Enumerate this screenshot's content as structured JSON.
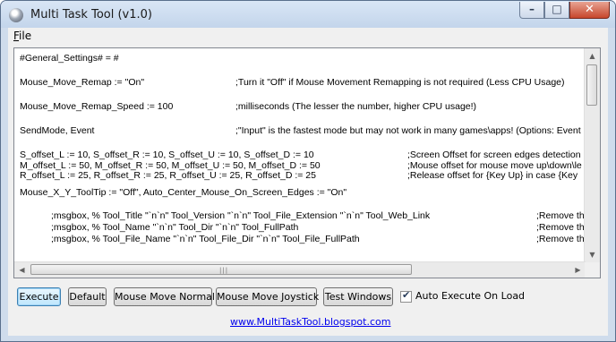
{
  "window": {
    "title": "Multi Task Tool (v1.0)",
    "caption_buttons": {
      "minimize": "–",
      "maximize": "□",
      "close": "✕"
    }
  },
  "menu": {
    "file_label": "File"
  },
  "editor": {
    "lines": [
      {
        "code": "#General_Settings# = #",
        "comment": ""
      },
      {
        "code": "",
        "comment": ""
      },
      {
        "code": "Mouse_Move_Remap := \"On\"",
        "comment": ";Turn it \"Off\" if Mouse Movement Remapping is not required (Less CPU Usage)"
      },
      {
        "code": "",
        "comment": ""
      },
      {
        "code": "Mouse_Move_Remap_Speed := 100",
        "comment": ";milliseconds (The lesser the number, higher CPU usage!)"
      },
      {
        "code": "",
        "comment": ""
      },
      {
        "code": "SendMode, Event",
        "comment": ";\"Input\" is the fastest mode but may not work in many games\\apps! (Options: Event"
      },
      {
        "code": "",
        "comment": ""
      },
      {
        "code": "S_offset_L := 10, S_offset_R := 10, S_offset_U := 10, S_offset_D := 10",
        "comment": ";Screen Offset for screen edges detection"
      },
      {
        "code": "M_offset_L := 50, M_offset_R := 50, M_offset_U := 50, M_offset_D := 50",
        "comment": ";Mouse offset for mouse move up\\down\\le"
      },
      {
        "code": "R_offset_L := 25, R_offset_R := 25, R_offset_U := 25, R_offset_D := 25",
        "comment": ";Release offset for {Key Up} in case {Key"
      },
      {
        "code": "",
        "comment": ""
      },
      {
        "code": "Mouse_X_Y_ToolTip := \"Off\", Auto_Center_Mouse_On_Screen_Edges := \"On\"",
        "comment": ""
      },
      {
        "code": "",
        "comment": ""
      },
      {
        "code": "            ;msgbox, % Tool_Title \"`n`n\" Tool_Version \"`n`n\" Tool_File_Extension \"`n`n\" Tool_Web_Link",
        "comment": ";Remove th"
      },
      {
        "code": "            ;msgbox, % Tool_Name \"`n`n\" Tool_Dir \"`n`n\" Tool_FullPath",
        "comment": ";Remove th"
      },
      {
        "code": "            ;msgbox, % Tool_File_Name \"`n`n\" Tool_File_Dir \"`n`n\" Tool_File_FullPath",
        "comment": ";Remove th"
      }
    ]
  },
  "buttons": {
    "execute": "Execute",
    "default": "Default",
    "mouse_move_normal": "Mouse Move Normal",
    "mouse_move_joystick": "Mouse Move Joystick",
    "test_windows": "Test Windows"
  },
  "auto_execute": {
    "label": "Auto Execute On Load",
    "checked": true
  },
  "link": {
    "text": "www.MultiTaskTool.blogspot.com"
  },
  "colors": {
    "link": "#0000ee",
    "window_frame": "#cfdcec",
    "close_button": "#c7462c",
    "default_button": "#3c7fb1"
  },
  "icons": {
    "app": "app-disc-icon",
    "checkbox": "checkmark-icon"
  }
}
